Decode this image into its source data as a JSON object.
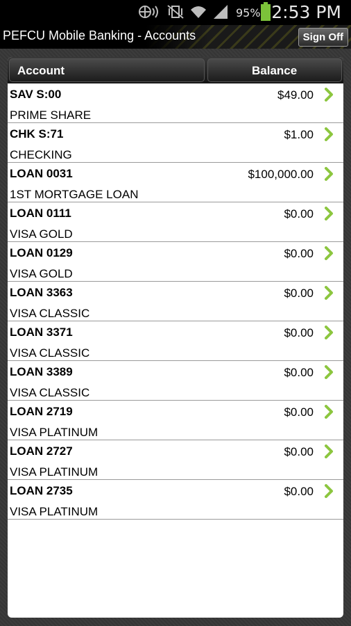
{
  "status_bar": {
    "battery_percent": "95%",
    "time": "2:53 PM",
    "icons": [
      "gps-icon",
      "vibrate-icon",
      "wifi-icon",
      "signal-icon",
      "battery-icon"
    ]
  },
  "title_bar": {
    "title": "PEFCU Mobile Banking - Accounts",
    "sign_off": "Sign Off"
  },
  "table": {
    "headers": {
      "account": "Account",
      "balance": "Balance"
    },
    "rows": [
      {
        "name": "SAV S:00",
        "desc": "PRIME SHARE",
        "balance": "$49.00"
      },
      {
        "name": "CHK S:71",
        "desc": "CHECKING",
        "balance": "$1.00"
      },
      {
        "name": "LOAN 0031",
        "desc": "1ST MORTGAGE LOAN",
        "balance": "$100,000.00"
      },
      {
        "name": "LOAN 0111",
        "desc": "VISA GOLD",
        "balance": "$0.00"
      },
      {
        "name": "LOAN 0129",
        "desc": "VISA GOLD",
        "balance": "$0.00"
      },
      {
        "name": "LOAN 3363",
        "desc": "VISA CLASSIC",
        "balance": "$0.00"
      },
      {
        "name": "LOAN 3371",
        "desc": "VISA CLASSIC",
        "balance": "$0.00"
      },
      {
        "name": "LOAN 3389",
        "desc": "VISA CLASSIC",
        "balance": "$0.00"
      },
      {
        "name": "LOAN 2719",
        "desc": "VISA PLATINUM",
        "balance": "$0.00"
      },
      {
        "name": "LOAN 2727",
        "desc": "VISA PLATINUM",
        "balance": "$0.00"
      },
      {
        "name": "LOAN 2735",
        "desc": "VISA PLATINUM",
        "balance": "$0.00"
      }
    ]
  },
  "colors": {
    "chevron": "#8cc63f",
    "battery": "#7cc23a"
  }
}
